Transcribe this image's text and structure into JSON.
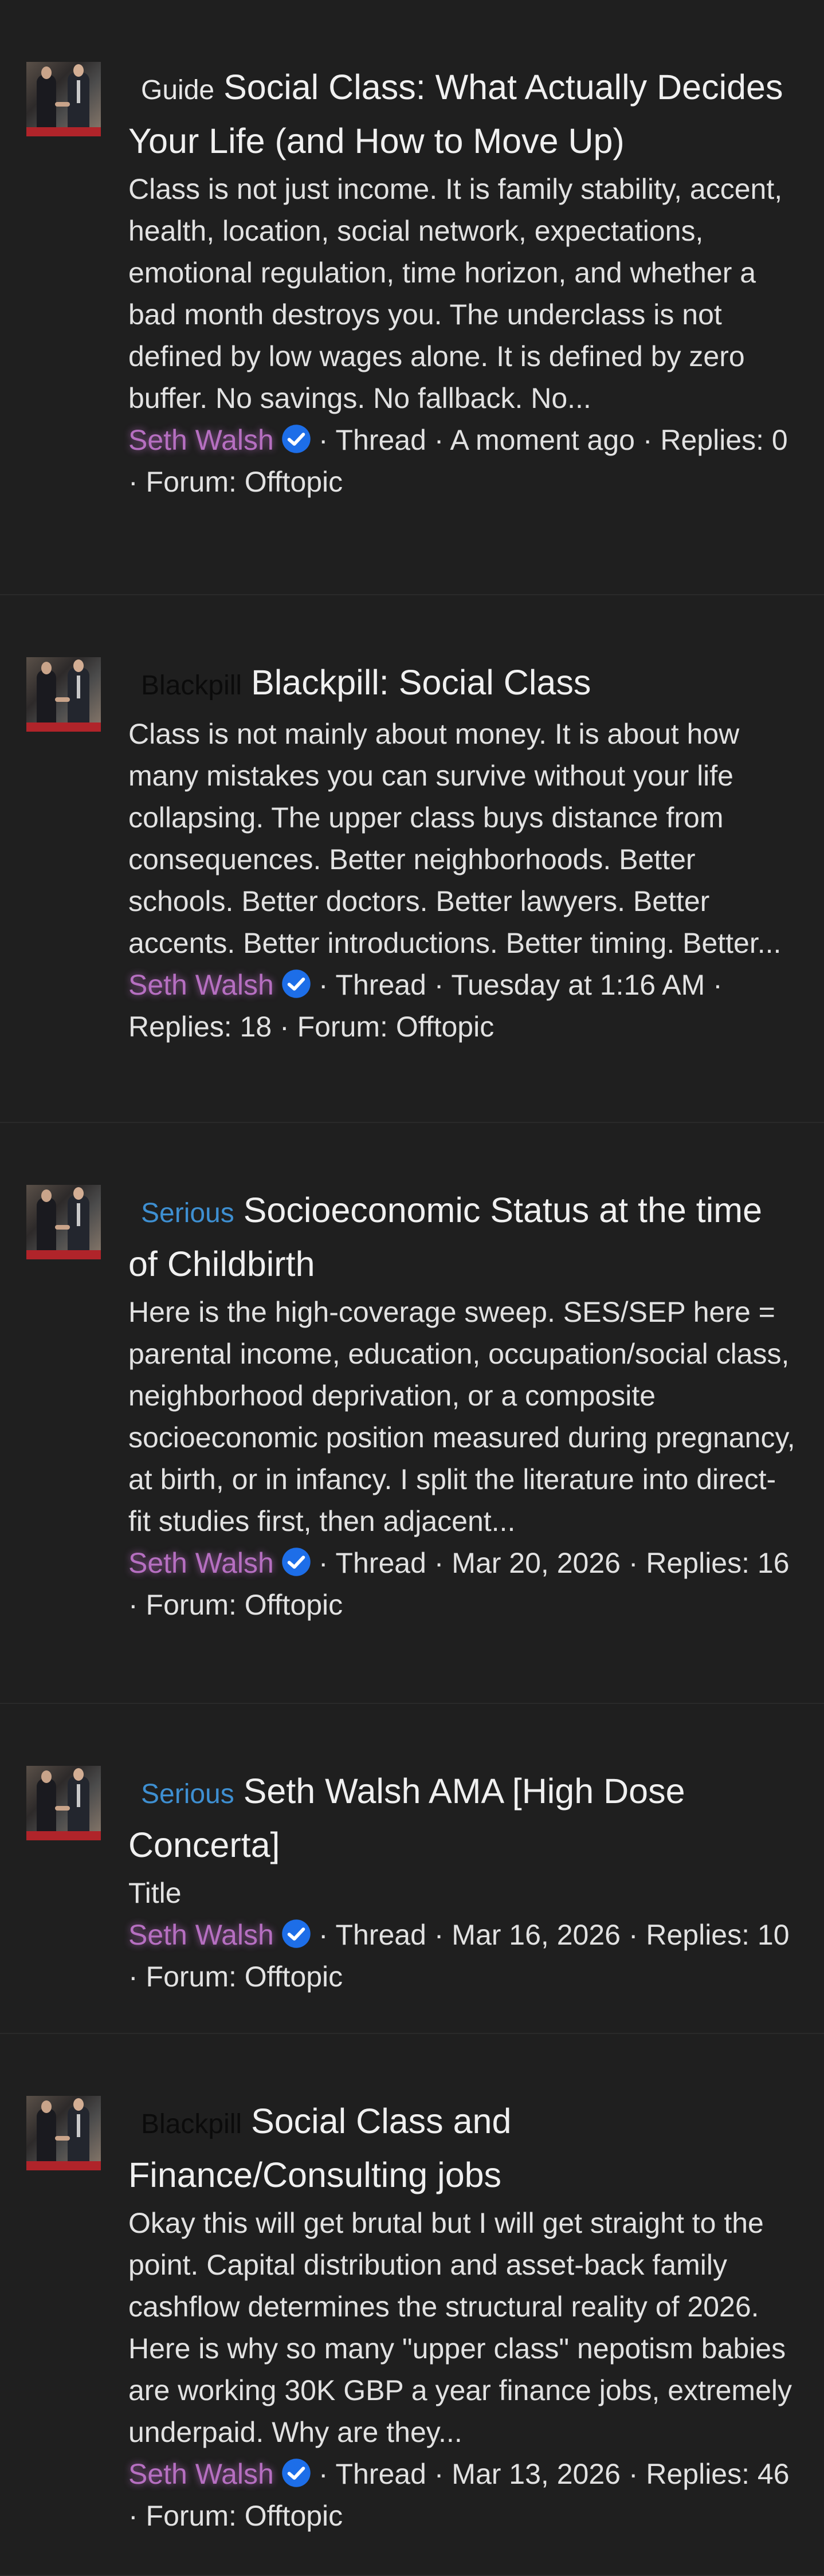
{
  "results": [
    {
      "prefix": "Guide",
      "title": "Social Class: What Actually Decides Your Life (and How to Move Up)",
      "snippet": "Class is not just income. It is family stability, accent, health, location, social network, expectations, emotional regulation, time horizon, and whether a bad month destroys you. The underclass is not defined by low wages alone. It is defined by zero buffer. No savings. No fallback. No...",
      "author": "Seth Walsh",
      "meta": "· Thread · A moment ago · Replies: 0 · Forum: Offtopic"
    },
    {
      "prefix": "Blackpill",
      "title": "Blackpill: Social Class",
      "snippet": "Class is not mainly about money. It is about how many mistakes you can survive without your life collapsing. The upper class buys distance from consequences. Better neighborhoods. Better schools. Better doctors. Better lawyers. Better accents. Better introductions. Better timing. Better...",
      "author": "Seth Walsh",
      "meta": "· Thread · Tuesday at 1:16 AM · Replies: 18 · Forum: Offtopic"
    },
    {
      "prefix": "Serious",
      "title": "Socioeconomic Status at the time of Childbirth",
      "snippet": "Here is the high-coverage sweep. SES/SEP here = parental income, education, occupation/social class, neighborhood deprivation, or a composite socioeconomic position measured during pregnancy, at birth, or in infancy. I split the literature into direct-fit studies first, then adjacent...",
      "author": "Seth Walsh",
      "meta": "· Thread · Mar 20, 2026 · Replies: 16 · Forum: Offtopic"
    },
    {
      "prefix": "Serious",
      "title": "Seth Walsh AMA [High Dose Concerta]",
      "snippet": "Title",
      "author": "Seth Walsh",
      "meta": "· Thread · Mar 16, 2026 · Replies: 10 · Forum: Offtopic"
    },
    {
      "prefix": "Blackpill",
      "title": "Social Class and Finance/Consulting jobs",
      "snippet": "Okay this will get brutal but I will get straight to the point. Capital distribution and asset-back family cashflow determines the structural reality of 2026. Here is why so many \"upper class\" nepotism babies are working 30K GBP a year finance jobs, extremely underpaid. Why are they...",
      "author": "Seth Walsh",
      "meta": "· Thread · Mar 13, 2026 · Replies: 46 · Forum: Offtopic"
    }
  ],
  "icons": {
    "avatar": "avatar-photo",
    "verified": "verified-check-icon"
  },
  "colors": {
    "background": "#1f1f1f",
    "username": "#b66fc1",
    "serious_prefix": "#3e8fd1",
    "verified_badge": "#1d6ee8"
  }
}
